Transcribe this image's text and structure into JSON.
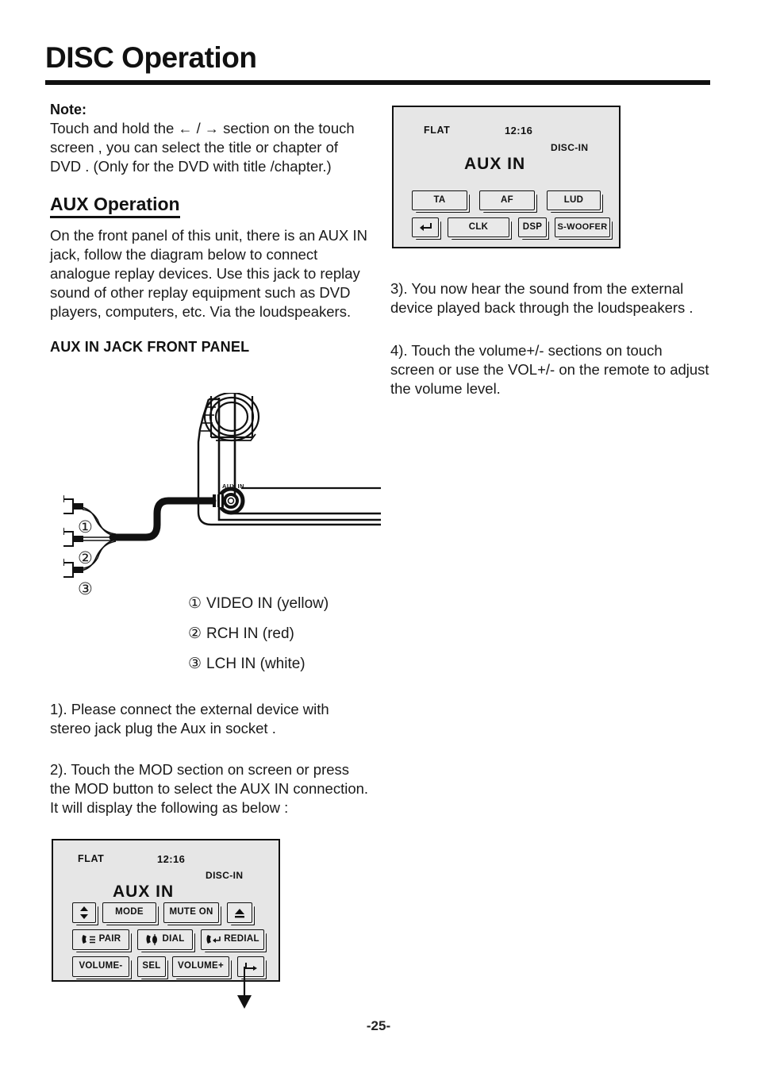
{
  "page": {
    "title": "DISC Operation",
    "number": "-25-"
  },
  "note": {
    "label": "Note:",
    "left_arrow": "←",
    "separator": "/",
    "right_arrow": "→",
    "line1_before": "Touch and hold the",
    "line1_after": "section on",
    "rest": "the touch screen , you can select the title or chapter of DVD . (Only for the DVD with title /chapter.)"
  },
  "aux_section": {
    "heading": "AUX Operation",
    "paragraph": "On the front panel of this unit, there is an AUX IN jack, follow the diagram below to connect analogue replay devices. Use this jack to replay sound of other replay equipment such as DVD players, computers, etc. Via the loudspeakers.",
    "subheading": "AUX IN JACK FRONT PANEL"
  },
  "diagram": {
    "jack_label": "AUX IN",
    "legend": [
      {
        "num": "①",
        "text": "VIDEO IN  (yellow)"
      },
      {
        "num": "②",
        "text": "RCH IN (red)"
      },
      {
        "num": "③",
        "text": "LCH IN (white)"
      }
    ],
    "callouts": [
      "①",
      "②",
      "③"
    ]
  },
  "steps": {
    "step1": "1). Please connect the external device with stereo jack plug the Aux in socket .",
    "step2": "2). Touch the MOD section on screen or press the MOD button to select the AUX IN connection. It will display the following as below :",
    "step3": "3). You now hear the sound from the external device played back through the loudspeakers .",
    "step4": "4). Touch the volume+/- sections on touch screen or use the VOL+/-  on the remote to adjust the volume level."
  },
  "display_top": {
    "eq": "FLAT",
    "clock": "12:16",
    "source": "DISC-IN",
    "mode": "AUX  IN",
    "keys": [
      {
        "label": "TA",
        "icon": ""
      },
      {
        "label": "AF",
        "icon": ""
      },
      {
        "label": "LUD",
        "icon": ""
      },
      {
        "label": "",
        "icon": "enter-arrow-icon"
      },
      {
        "label": "CLK",
        "icon": ""
      },
      {
        "label": "DSP",
        "icon": ""
      },
      {
        "label": "S-WOOFER",
        "icon": ""
      }
    ]
  },
  "display_bottom": {
    "eq": "FLAT",
    "clock": "12:16",
    "source": "DISC-IN",
    "mode": "AUX  IN",
    "keys": [
      {
        "label": "",
        "icon": "up-down-arrows-icon"
      },
      {
        "label": "MODE",
        "icon": ""
      },
      {
        "label": "MUTE ON",
        "icon": ""
      },
      {
        "label": "",
        "icon": "eject-icon"
      },
      {
        "label": "PAIR",
        "icon": "phone-pair-icon"
      },
      {
        "label": "DIAL",
        "icon": "phone-dial-icon"
      },
      {
        "label": "REDIAL",
        "icon": "phone-redial-icon"
      },
      {
        "label": "VOLUME-",
        "icon": ""
      },
      {
        "label": "SEL",
        "icon": ""
      },
      {
        "label": "VOLUME+",
        "icon": ""
      },
      {
        "label": "",
        "icon": "return-arrow-icon"
      }
    ]
  },
  "colors": {
    "ink": "#111111",
    "panel_bg": "#e6e6e6",
    "key_bg": "#e9e9e9"
  }
}
